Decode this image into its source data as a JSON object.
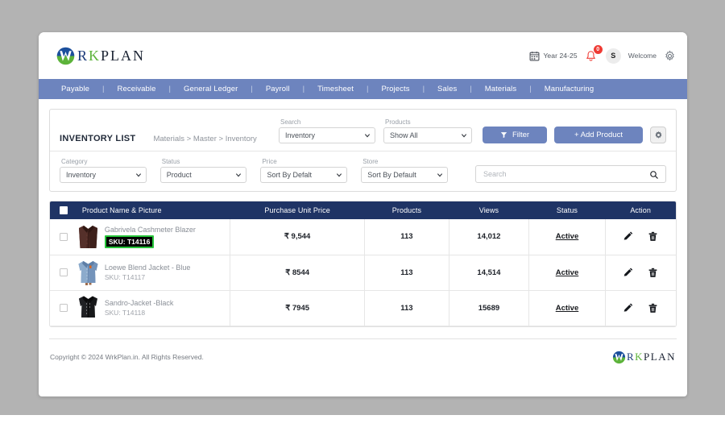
{
  "brand": {
    "name_r": "R",
    "name_k": "K",
    "name_plan": "PLAN",
    "mark": "w-circle-logo"
  },
  "topbar": {
    "year_label": "Year 24-25",
    "calendar_icon": "calendar-icon",
    "bell_icon": "bell-icon",
    "notification_count": "0",
    "avatar_initial": "S",
    "welcome_label": "Welcome",
    "settings_icon": "gear-icon"
  },
  "nav": {
    "items": [
      "Payable",
      "Receivable",
      "General Ledger",
      "Payroll",
      "Timesheet",
      "Projects",
      "Sales",
      "Materials",
      "Manufacturing"
    ],
    "separator": "|"
  },
  "header": {
    "title": "INVENTORY LIST",
    "breadcrumb": "Materials > Master > Inventory"
  },
  "filters": {
    "search_select": {
      "label": "Search",
      "value": "Inventory"
    },
    "products_select": {
      "label": "Products",
      "value": "Show All"
    },
    "filter_button": "Filter",
    "add_product_button": "+ Add Product",
    "settings_icon": "gear-icon",
    "category_select": {
      "label": "Category",
      "value": "Inventory"
    },
    "status_select": {
      "label": "Status",
      "value": "Product"
    },
    "price_select": {
      "label": "Price",
      "value": "Sort By Defalt"
    },
    "store_select": {
      "label": "Store",
      "value": "Sort By Default"
    },
    "search_input": {
      "placeholder": "Search",
      "value": ""
    }
  },
  "table": {
    "columns": [
      "Product Name & Picture",
      "Purchase Unit Price",
      "Products",
      "Views",
      "Status",
      "Action"
    ],
    "rows": [
      {
        "name": "Gabrivela Cashmeter Blazer",
        "sku": "SKU: T14116",
        "sku_highlighted": true,
        "thumb": "blazer-brown-thumbnail",
        "price": "₹ 9,544",
        "products": "113",
        "views": "14,012",
        "status": "Active",
        "edit_icon": "pencil-icon",
        "delete_icon": "trash-icon"
      },
      {
        "name": "Loewe Blend Jacket - Blue",
        "sku": "SKU: T14117",
        "sku_highlighted": false,
        "thumb": "jacket-blue-thumbnail",
        "price": "₹ 8544",
        "products": "113",
        "views": "14,514",
        "status": "Active",
        "edit_icon": "pencil-icon",
        "delete_icon": "trash-icon"
      },
      {
        "name": "Sandro-Jacket -Black",
        "sku": "SKU: T14118",
        "sku_highlighted": false,
        "thumb": "jacket-black-thumbnail",
        "price": "₹ 7945",
        "products": "113",
        "views": "15689",
        "status": "Active",
        "edit_icon": "pencil-icon",
        "delete_icon": "trash-icon"
      }
    ]
  },
  "footer": {
    "copyright": "Copyright © 2024 WrkPlan.in. All Rights Reserved."
  },
  "colors": {
    "nav_blue": "#6d84be",
    "table_header_navy": "#1f3465",
    "button_blue": "#6d84be",
    "badge_red": "#ef3b34",
    "sku_highlight_green": "#27c53b",
    "page_bg": "#b3b3b3"
  }
}
